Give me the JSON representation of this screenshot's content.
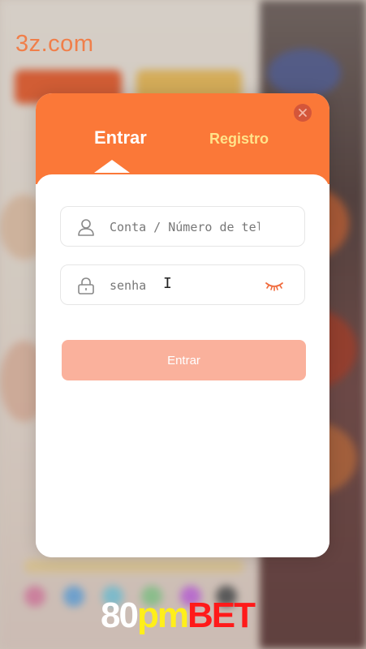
{
  "site_label": "3z.com",
  "modal": {
    "tabs": [
      {
        "label": "Entrar",
        "active": true
      },
      {
        "label": "Registro",
        "active": false
      }
    ],
    "account_field": {
      "placeholder": "Conta / Número de telefone",
      "value": ""
    },
    "password_field": {
      "placeholder": "senha",
      "value": ""
    },
    "submit_label": "Entrar",
    "close_icon": "close-icon",
    "eye_icon": "eye-closed-icon"
  },
  "brand": {
    "part1": "80",
    "part2": "pm",
    "part3": "BET"
  },
  "colors": {
    "accent": "#fb7838",
    "register_tab": "#ffe38a",
    "submit_disabled": "#fab19c",
    "close": "#d4563a"
  }
}
